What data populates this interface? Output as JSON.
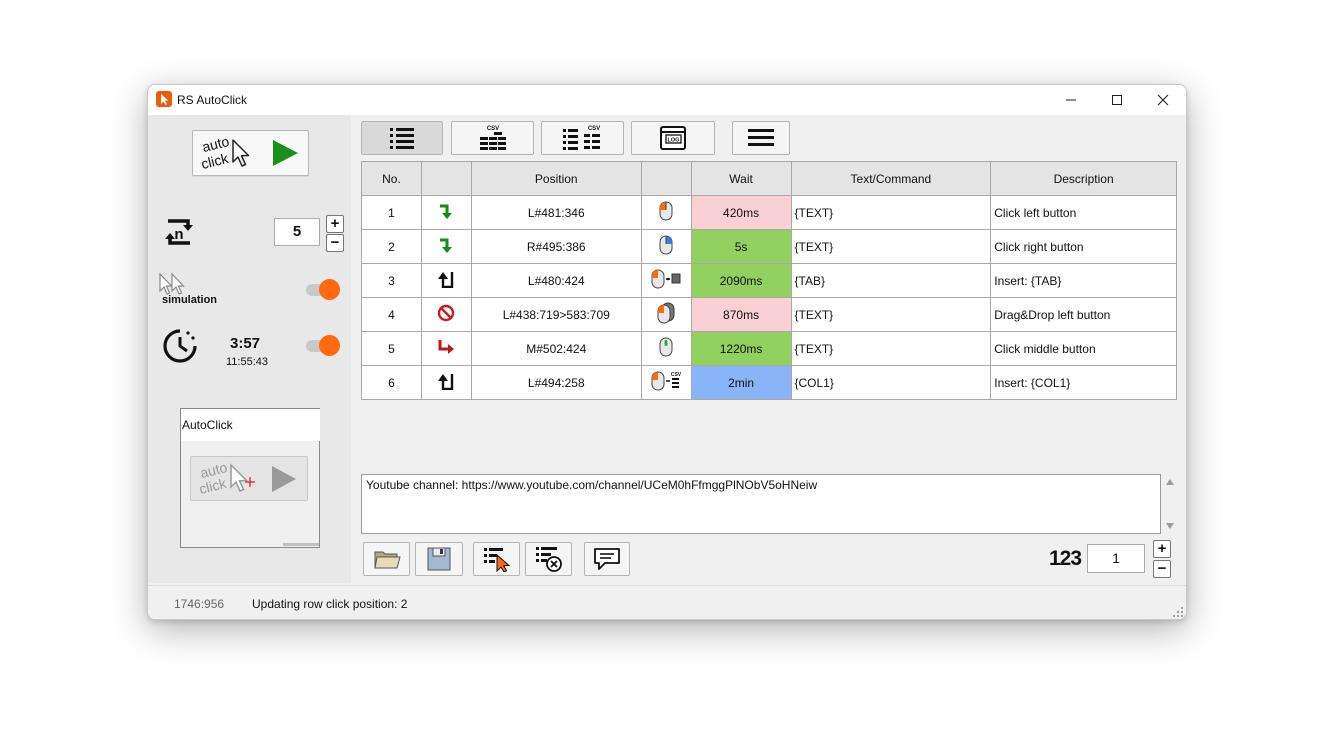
{
  "window": {
    "title": "RS AutoClick"
  },
  "sidebar": {
    "start_button": {
      "line1": "auto",
      "line2": "click"
    },
    "repeat": {
      "value": "5"
    },
    "simulation": {
      "label": "simulation"
    },
    "timer": {
      "value": "3:57",
      "time": "11:55:43"
    },
    "preview": {
      "title": "AutoClick",
      "line1": "auto",
      "line2": "click"
    }
  },
  "toolbar": {
    "csv_label": "CSV"
  },
  "table": {
    "headers": [
      "No.",
      "",
      "Position",
      "",
      "Wait",
      "Text/Command",
      "Description"
    ],
    "rows": [
      {
        "no": "1",
        "action_icon": "arrow-down-right",
        "position": "L#481:346",
        "mouse_icon": "mouse-left",
        "wait": "420ms",
        "wait_color": "#f9d0d4",
        "text": "{TEXT}",
        "description": "Click left button"
      },
      {
        "no": "2",
        "action_icon": "arrow-down-right",
        "position": "R#495:386",
        "mouse_icon": "mouse-right",
        "wait": "5s",
        "wait_color": "#92d05f",
        "text": "{TEXT}",
        "description": "Click right button"
      },
      {
        "no": "3",
        "action_icon": "return-up",
        "position": "L#480:424",
        "mouse_icon": "mouse-key",
        "wait": "2090ms",
        "wait_color": "#92d05f",
        "text": "{TAB}",
        "description": "Insert: {TAB}"
      },
      {
        "no": "4",
        "action_icon": "no-entry",
        "position": "L#438:719>583:709",
        "mouse_icon": "mouse-drag",
        "wait": "870ms",
        "wait_color": "#f9d0d4",
        "text": "{TEXT}",
        "description": "Drag&Drop left button"
      },
      {
        "no": "5",
        "action_icon": "arrow-down-right-red",
        "position": "M#502:424",
        "mouse_icon": "mouse-middle",
        "wait": "1220ms",
        "wait_color": "#92d05f",
        "text": "{TEXT}",
        "description": "Click middle button"
      },
      {
        "no": "6",
        "action_icon": "return-up",
        "position": "L#494:258",
        "mouse_icon": "mouse-csv",
        "wait": "2min",
        "wait_color": "#8ab4f8",
        "text": "{COL1}",
        "description": "Insert: {COL1}"
      }
    ]
  },
  "notes": {
    "text": "Youtube channel: https://www.youtube.com/channel/UCeM0hFfmggPlNObV5oHNeiw"
  },
  "bottom": {
    "counter_label": "123",
    "counter_value": "1"
  },
  "status": {
    "coords": "1746:956",
    "message": "Updating row click position: 2"
  }
}
